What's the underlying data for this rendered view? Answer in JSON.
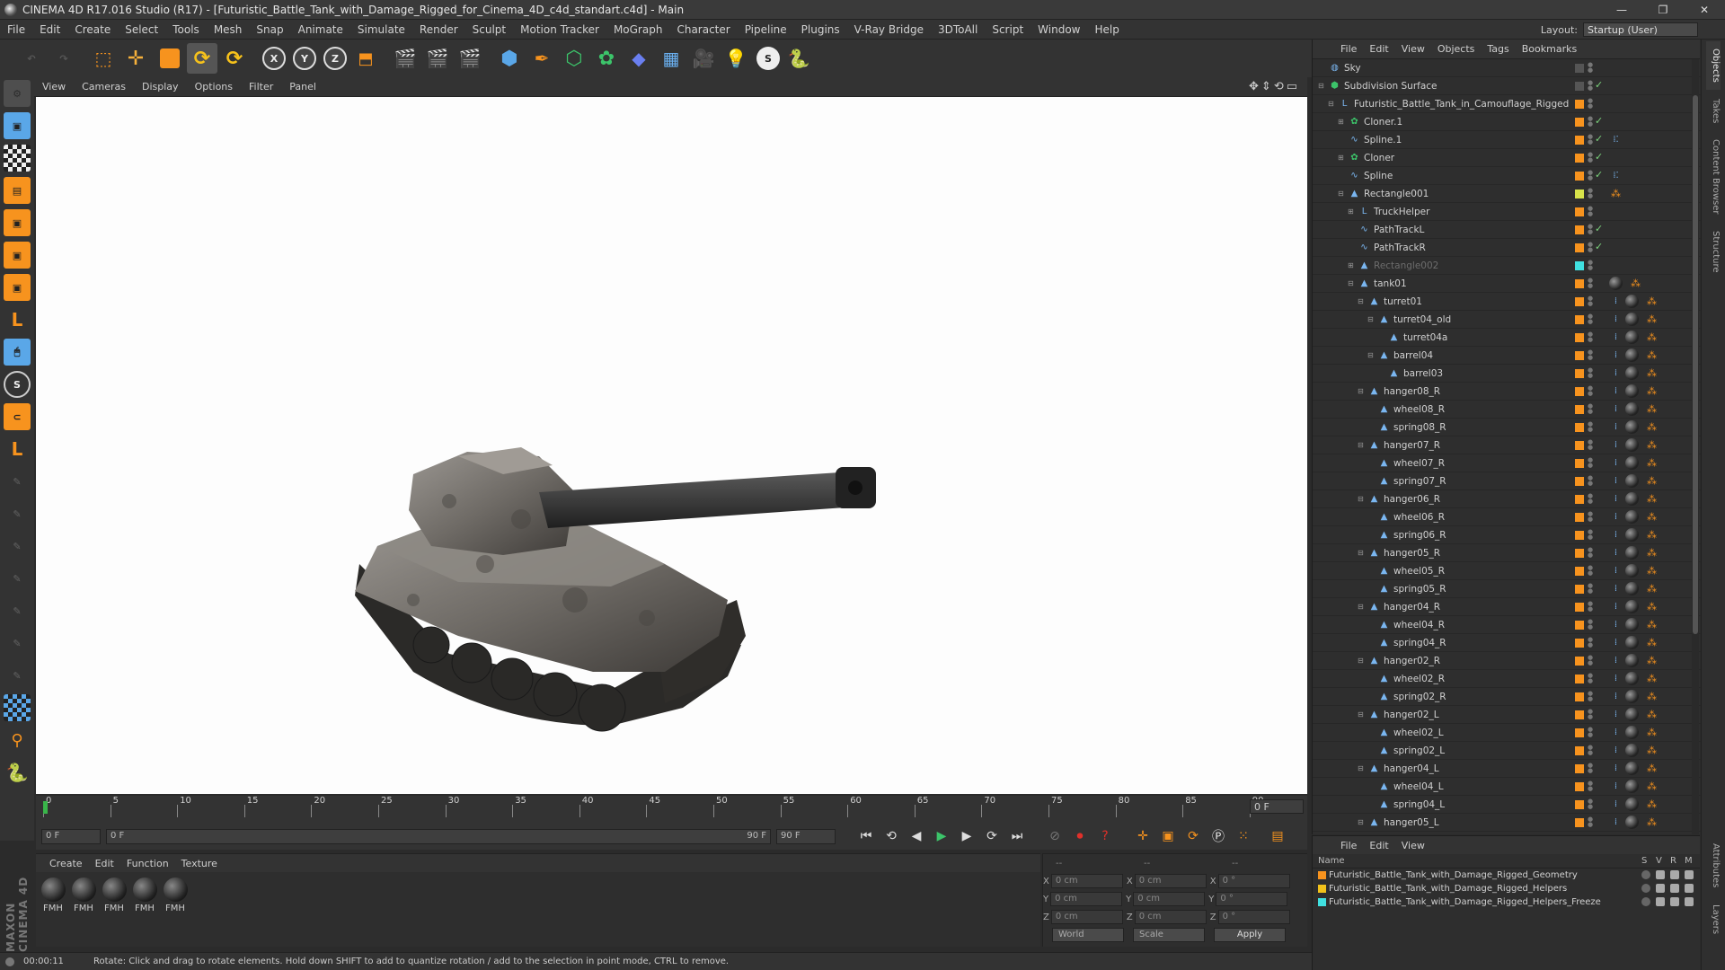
{
  "window": {
    "title": "CINEMA 4D R17.016 Studio (R17) - [Futuristic_Battle_Tank_with_Damage_Rigged_for_Cinema_4D_c4d_standart.c4d] - Main",
    "minimize": "—",
    "maximize": "❐",
    "close": "✕"
  },
  "menu": [
    "File",
    "Edit",
    "Create",
    "Select",
    "Tools",
    "Mesh",
    "Snap",
    "Animate",
    "Simulate",
    "Render",
    "Sculpt",
    "Motion Tracker",
    "MoGraph",
    "Character",
    "Pipeline",
    "Plugins",
    "V-Ray Bridge",
    "3DToAll",
    "Script",
    "Window",
    "Help"
  ],
  "layout": {
    "label": "Layout:",
    "value": "Startup (User)"
  },
  "viewport": {
    "menu": [
      "View",
      "Cameras",
      "Display",
      "Options",
      "Filter",
      "Panel"
    ]
  },
  "timeline": {
    "ticks": [
      "0",
      "5",
      "10",
      "15",
      "20",
      "25",
      "30",
      "35",
      "40",
      "45",
      "50",
      "55",
      "60",
      "65",
      "70",
      "75",
      "80",
      "85",
      "90"
    ],
    "current": "0 F"
  },
  "transport": {
    "start": "0 F",
    "range_start": "0 F",
    "range_end": "90 F",
    "end": "90 F"
  },
  "materials": {
    "menu": [
      "Create",
      "Edit",
      "Function",
      "Texture"
    ],
    "items": [
      "FMH",
      "FMH",
      "FMH",
      "FMH",
      "FMH"
    ]
  },
  "coords": {
    "headers": [
      "--",
      "--",
      "--"
    ],
    "rows": [
      {
        "a": "X",
        "v1": "0 cm",
        "b": "X",
        "v2": "0 cm",
        "c": "X",
        "v3": "0 °"
      },
      {
        "a": "Y",
        "v1": "0 cm",
        "b": "Y",
        "v2": "0 cm",
        "c": "Y",
        "v3": "0 °"
      },
      {
        "a": "Z",
        "v1": "0 cm",
        "b": "Z",
        "v2": "0 cm",
        "c": "Z",
        "v3": "0 °"
      }
    ],
    "world": "World",
    "scale": "Scale",
    "apply": "Apply"
  },
  "status": {
    "time": "00:00:11",
    "message": "Rotate: Click and drag to rotate elements. Hold down SHIFT to add to quantize rotation / add to the selection in point mode, CTRL to remove."
  },
  "brand": "MAXON CINEMA 4D",
  "objects": {
    "menu": [
      "File",
      "Edit",
      "View",
      "Objects",
      "Tags",
      "Bookmarks"
    ],
    "items": [
      {
        "name": "Sky",
        "depth": 0,
        "expand": "",
        "icon": "sky",
        "color": "#555",
        "tags": "none",
        "dim": false
      },
      {
        "name": "Subdivision Surface",
        "depth": 0,
        "expand": "⊟",
        "icon": "subdiv",
        "color": "#555",
        "tags": "none",
        "dim": false
      },
      {
        "name": "Futuristic_Battle_Tank_in_Camouflage_Rigged",
        "depth": 1,
        "expand": "⊟",
        "icon": "null",
        "color": "#f7931e",
        "tags": "none",
        "dim": false
      },
      {
        "name": "Cloner.1",
        "depth": 2,
        "expand": "⊞",
        "icon": "cloner",
        "color": "#f7931e",
        "tags": "none",
        "dim": false
      },
      {
        "name": "Spline.1",
        "depth": 2,
        "expand": "",
        "icon": "spline",
        "color": "#f7931e",
        "tags": "dot",
        "dim": false
      },
      {
        "name": "Cloner",
        "depth": 2,
        "expand": "⊞",
        "icon": "cloner",
        "color": "#f7931e",
        "tags": "none",
        "dim": false
      },
      {
        "name": "Spline",
        "depth": 2,
        "expand": "",
        "icon": "spline",
        "color": "#f7931e",
        "tags": "dot",
        "dim": false
      },
      {
        "name": "Rectangle001",
        "depth": 2,
        "expand": "⊟",
        "icon": "poly",
        "color": "#d7e34a",
        "tags": "ctl",
        "dim": false
      },
      {
        "name": "TruckHelper",
        "depth": 3,
        "expand": "⊞",
        "icon": "null",
        "color": "#f7931e",
        "tags": "none",
        "dim": false
      },
      {
        "name": "PathTrackL",
        "depth": 3,
        "expand": "",
        "icon": "spline",
        "color": "#f7931e",
        "tags": "none",
        "dim": false
      },
      {
        "name": "PathTrackR",
        "depth": 3,
        "expand": "",
        "icon": "spline",
        "color": "#f7931e",
        "tags": "none",
        "dim": false
      },
      {
        "name": "Rectangle002",
        "depth": 3,
        "expand": "⊞",
        "icon": "poly",
        "color": "#40e0e0",
        "tags": "none",
        "dim": true
      },
      {
        "name": "tank01",
        "depth": 3,
        "expand": "⊟",
        "icon": "poly",
        "color": "#f7931e",
        "tags": "full",
        "dim": false
      },
      {
        "name": "turret01",
        "depth": 4,
        "expand": "⊟",
        "icon": "poly",
        "color": "#f7931e",
        "tags": "full",
        "dim": false
      },
      {
        "name": "turret04_old",
        "depth": 5,
        "expand": "⊟",
        "icon": "poly",
        "color": "#f7931e",
        "tags": "full",
        "dim": false
      },
      {
        "name": "turret04a",
        "depth": 6,
        "expand": "",
        "icon": "poly",
        "color": "#f7931e",
        "tags": "full",
        "dim": false
      },
      {
        "name": "barrel04",
        "depth": 5,
        "expand": "⊟",
        "icon": "poly",
        "color": "#f7931e",
        "tags": "full",
        "dim": false
      },
      {
        "name": "barrel03",
        "depth": 6,
        "expand": "",
        "icon": "poly",
        "color": "#f7931e",
        "tags": "full",
        "dim": false
      },
      {
        "name": "hanger08_R",
        "depth": 4,
        "expand": "⊟",
        "icon": "poly",
        "color": "#f7931e",
        "tags": "full",
        "dim": false
      },
      {
        "name": "wheel08_R",
        "depth": 5,
        "expand": "",
        "icon": "poly",
        "color": "#f7931e",
        "tags": "full",
        "dim": false
      },
      {
        "name": "spring08_R",
        "depth": 5,
        "expand": "",
        "icon": "poly",
        "color": "#f7931e",
        "tags": "full",
        "dim": false
      },
      {
        "name": "hanger07_R",
        "depth": 4,
        "expand": "⊟",
        "icon": "poly",
        "color": "#f7931e",
        "tags": "full",
        "dim": false
      },
      {
        "name": "wheel07_R",
        "depth": 5,
        "expand": "",
        "icon": "poly",
        "color": "#f7931e",
        "tags": "full",
        "dim": false
      },
      {
        "name": "spring07_R",
        "depth": 5,
        "expand": "",
        "icon": "poly",
        "color": "#f7931e",
        "tags": "full",
        "dim": false
      },
      {
        "name": "hanger06_R",
        "depth": 4,
        "expand": "⊟",
        "icon": "poly",
        "color": "#f7931e",
        "tags": "full",
        "dim": false
      },
      {
        "name": "wheel06_R",
        "depth": 5,
        "expand": "",
        "icon": "poly",
        "color": "#f7931e",
        "tags": "full",
        "dim": false
      },
      {
        "name": "spring06_R",
        "depth": 5,
        "expand": "",
        "icon": "poly",
        "color": "#f7931e",
        "tags": "full",
        "dim": false
      },
      {
        "name": "hanger05_R",
        "depth": 4,
        "expand": "⊟",
        "icon": "poly",
        "color": "#f7931e",
        "tags": "full",
        "dim": false
      },
      {
        "name": "wheel05_R",
        "depth": 5,
        "expand": "",
        "icon": "poly",
        "color": "#f7931e",
        "tags": "full",
        "dim": false
      },
      {
        "name": "spring05_R",
        "depth": 5,
        "expand": "",
        "icon": "poly",
        "color": "#f7931e",
        "tags": "full",
        "dim": false
      },
      {
        "name": "hanger04_R",
        "depth": 4,
        "expand": "⊟",
        "icon": "poly",
        "color": "#f7931e",
        "tags": "full",
        "dim": false
      },
      {
        "name": "wheel04_R",
        "depth": 5,
        "expand": "",
        "icon": "poly",
        "color": "#f7931e",
        "tags": "full",
        "dim": false
      },
      {
        "name": "spring04_R",
        "depth": 5,
        "expand": "",
        "icon": "poly",
        "color": "#f7931e",
        "tags": "full",
        "dim": false
      },
      {
        "name": "hanger02_R",
        "depth": 4,
        "expand": "⊟",
        "icon": "poly",
        "color": "#f7931e",
        "tags": "full",
        "dim": false
      },
      {
        "name": "wheel02_R",
        "depth": 5,
        "expand": "",
        "icon": "poly",
        "color": "#f7931e",
        "tags": "full",
        "dim": false
      },
      {
        "name": "spring02_R",
        "depth": 5,
        "expand": "",
        "icon": "poly",
        "color": "#f7931e",
        "tags": "full",
        "dim": false
      },
      {
        "name": "hanger02_L",
        "depth": 4,
        "expand": "⊟",
        "icon": "poly",
        "color": "#f7931e",
        "tags": "full",
        "dim": false
      },
      {
        "name": "wheel02_L",
        "depth": 5,
        "expand": "",
        "icon": "poly",
        "color": "#f7931e",
        "tags": "full",
        "dim": false
      },
      {
        "name": "spring02_L",
        "depth": 5,
        "expand": "",
        "icon": "poly",
        "color": "#f7931e",
        "tags": "full",
        "dim": false
      },
      {
        "name": "hanger04_L",
        "depth": 4,
        "expand": "⊟",
        "icon": "poly",
        "color": "#f7931e",
        "tags": "full",
        "dim": false
      },
      {
        "name": "wheel04_L",
        "depth": 5,
        "expand": "",
        "icon": "poly",
        "color": "#f7931e",
        "tags": "full",
        "dim": false
      },
      {
        "name": "spring04_L",
        "depth": 5,
        "expand": "",
        "icon": "poly",
        "color": "#f7931e",
        "tags": "full",
        "dim": false
      },
      {
        "name": "hanger05_L",
        "depth": 4,
        "expand": "⊟",
        "icon": "poly",
        "color": "#f7931e",
        "tags": "full",
        "dim": false
      }
    ]
  },
  "layers": {
    "menu": [
      "File",
      "Edit",
      "View"
    ],
    "cols": {
      "name": "Name",
      "s": "S",
      "v": "V",
      "r": "R",
      "m": "M"
    },
    "items": [
      {
        "name": "Futuristic_Battle_Tank_with_Damage_Rigged_Geometry",
        "color": "#f7931e"
      },
      {
        "name": "Futuristic_Battle_Tank_with_Damage_Rigged_Helpers",
        "color": "#f2c21b"
      },
      {
        "name": "Futuristic_Battle_Tank_with_Damage_Rigged_Helpers_Freeze",
        "color": "#40e0e0"
      }
    ]
  },
  "sidetabs": [
    "Objects",
    "Takes",
    "Content Browser",
    "Structure",
    "Attributes",
    "Layers"
  ]
}
